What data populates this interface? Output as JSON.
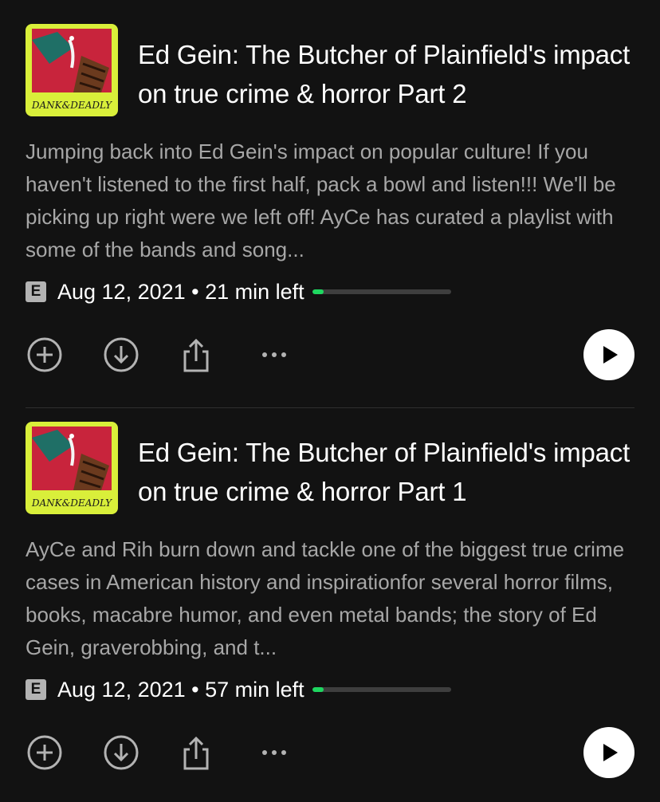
{
  "colors": {
    "background": "#121212",
    "title": "#ffffff",
    "description": "#a7a7a7",
    "progress_fill": "#1ed760",
    "progress_track": "#3e3e3e",
    "play_button": "#ffffff"
  },
  "episodes": [
    {
      "cover_text": "DANK&DEADLY",
      "title": "Ed Gein: The Butcher of Plainfield's impact on true crime & horror Part 2",
      "description": "Jumping back into Ed Gein's impact on popular culture! If you haven't listened to the first half, pack a bowl and listen!!! We'll be picking up right were we left off! AyCe has curated a playlist with some of the bands and song...",
      "explicit_badge": "E",
      "meta": "Aug 12, 2021 • 21 min left",
      "progress_fraction": 0.08,
      "icons": [
        "add-circle-icon",
        "download-icon",
        "share-icon",
        "more-icon",
        "play-icon"
      ]
    },
    {
      "cover_text": "DANK&DEADLY",
      "title": "Ed Gein: The Butcher of Plainfield's impact on true crime & horror Part 1",
      "description": "AyCe and Rih burn down and tackle one of the biggest true crime cases in American history and inspirationfor several horror films, books, macabre humor, and even metal bands; the story of Ed Gein, graverobbing, and t...",
      "explicit_badge": "E",
      "meta": "Aug 12, 2021 • 57 min left",
      "progress_fraction": 0.08,
      "icons": [
        "add-circle-icon",
        "download-icon",
        "share-icon",
        "more-icon",
        "play-icon"
      ]
    }
  ]
}
